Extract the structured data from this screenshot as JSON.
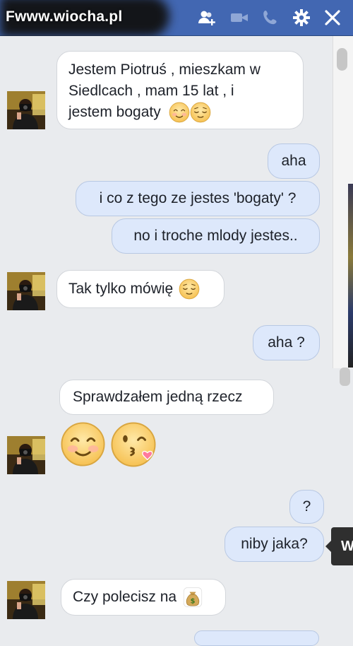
{
  "header": {
    "title": "Fwww.wiocha.pl",
    "icons": [
      "add-friend-icon",
      "video-call-icon",
      "phone-icon",
      "gear-icon",
      "close-icon"
    ],
    "bg_color": "#4267b2"
  },
  "messages": [
    {
      "from": "them",
      "lines": [
        "Jestem Piotruś , mieszkam w",
        "Siedlcach , mam 15 lat , i",
        "jestem bogaty"
      ],
      "emoji": [
        "smiling-face-icon",
        "relieved-face-icon"
      ]
    },
    {
      "from": "me",
      "text": "aha"
    },
    {
      "from": "me",
      "text": "i co z tego ze jestes 'bogaty' ?"
    },
    {
      "from": "me",
      "text": "no i troche mlody jestes.."
    },
    {
      "from": "them",
      "text": "Tak tylko mówię",
      "emoji": [
        "relieved-face-icon"
      ]
    },
    {
      "from": "me",
      "text": "aha ?"
    },
    {
      "from": "them",
      "text": "Sprawdzałem jedną rzecz"
    },
    {
      "from": "them",
      "emoji": [
        "smiling-face-icon",
        "kissing-face-icon"
      ]
    },
    {
      "from": "me",
      "text": "?"
    },
    {
      "from": "me",
      "text": "niby jaka?"
    },
    {
      "from": "them",
      "text": "Czy polecisz na",
      "emoji": [
        "money-bag-icon"
      ]
    }
  ],
  "tooltip": {
    "text": "W"
  },
  "colors": {
    "incoming": "#ffffff",
    "outgoing": "#dde8fb",
    "background": "#e9ebee"
  }
}
